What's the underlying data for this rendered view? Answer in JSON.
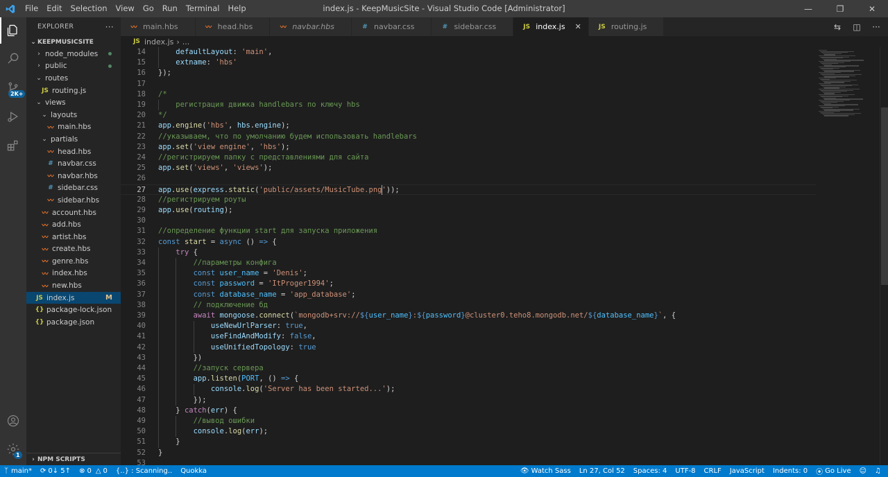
{
  "window": {
    "title": "index.js - KeepMusicSite - Visual Studio Code [Administrator]",
    "menu": [
      "File",
      "Edit",
      "Selection",
      "View",
      "Go",
      "Run",
      "Terminal",
      "Help"
    ]
  },
  "activity": {
    "scm_badge": "2K+",
    "settings_badge": "1"
  },
  "explorer": {
    "header": "EXPLORER",
    "more": "···",
    "folder": "KEEPMUSICSITE",
    "items": [
      {
        "label": "node_modules",
        "type": "folder",
        "open": false,
        "depth": 1,
        "status": "dot"
      },
      {
        "label": "public",
        "type": "folder",
        "open": false,
        "depth": 1,
        "status": "dot"
      },
      {
        "label": "routes",
        "type": "folder",
        "open": true,
        "depth": 1
      },
      {
        "label": "routing.js",
        "type": "js",
        "depth": 2
      },
      {
        "label": "views",
        "type": "folder",
        "open": true,
        "depth": 1
      },
      {
        "label": "layouts",
        "type": "folder",
        "open": true,
        "depth": 2
      },
      {
        "label": "main.hbs",
        "type": "hbs",
        "depth": 3
      },
      {
        "label": "partials",
        "type": "folder",
        "open": true,
        "depth": 2
      },
      {
        "label": "head.hbs",
        "type": "hbs",
        "depth": 3
      },
      {
        "label": "navbar.css",
        "type": "css",
        "depth": 3
      },
      {
        "label": "navbar.hbs",
        "type": "hbs",
        "depth": 3
      },
      {
        "label": "sidebar.css",
        "type": "css",
        "depth": 3
      },
      {
        "label": "sidebar.hbs",
        "type": "hbs",
        "depth": 3
      },
      {
        "label": "account.hbs",
        "type": "hbs",
        "depth": 2
      },
      {
        "label": "add.hbs",
        "type": "hbs",
        "depth": 2
      },
      {
        "label": "artist.hbs",
        "type": "hbs",
        "depth": 2
      },
      {
        "label": "create.hbs",
        "type": "hbs",
        "depth": 2
      },
      {
        "label": "genre.hbs",
        "type": "hbs",
        "depth": 2
      },
      {
        "label": "index.hbs",
        "type": "hbs",
        "depth": 2
      },
      {
        "label": "new.hbs",
        "type": "hbs",
        "depth": 2
      },
      {
        "label": "index.js",
        "type": "js",
        "depth": 1,
        "status": "M",
        "selected": true
      },
      {
        "label": "package-lock.json",
        "type": "json",
        "depth": 1
      },
      {
        "label": "package.json",
        "type": "json",
        "depth": 1
      }
    ],
    "npm_scripts": "NPM SCRIPTS"
  },
  "tabs": [
    {
      "label": "main.hbs",
      "type": "hbs"
    },
    {
      "label": "head.hbs",
      "type": "hbs"
    },
    {
      "label": "navbar.hbs",
      "type": "hbs",
      "italic": true
    },
    {
      "label": "navbar.css",
      "type": "css"
    },
    {
      "label": "sidebar.css",
      "type": "css"
    },
    {
      "label": "index.js",
      "type": "js",
      "active": true
    },
    {
      "label": "routing.js",
      "type": "js"
    }
  ],
  "breadcrumb": {
    "file": "index.js",
    "rest": "..."
  },
  "editor": {
    "current_line": 27,
    "lines": [
      {
        "n": 14,
        "t": [
          [
            "    ",
            "pl"
          ],
          [
            "defaultLayout",
            "var"
          ],
          [
            ": ",
            "pl"
          ],
          [
            "'main'",
            "str"
          ],
          [
            ",",
            "pl"
          ]
        ]
      },
      {
        "n": 15,
        "t": [
          [
            "    ",
            "pl"
          ],
          [
            "extname",
            "var"
          ],
          [
            ": ",
            "pl"
          ],
          [
            "'hbs'",
            "str"
          ]
        ]
      },
      {
        "n": 16,
        "t": [
          [
            "});",
            "pl"
          ]
        ]
      },
      {
        "n": 17,
        "t": []
      },
      {
        "n": 18,
        "t": [
          [
            "/*",
            "com"
          ]
        ]
      },
      {
        "n": 19,
        "t": [
          [
            "    регистрация движка handlebars по ключу hbs",
            "com"
          ]
        ]
      },
      {
        "n": 20,
        "t": [
          [
            "*/",
            "com"
          ]
        ]
      },
      {
        "n": 21,
        "t": [
          [
            "app",
            "var"
          ],
          [
            ".",
            "pl"
          ],
          [
            "engine",
            "fn"
          ],
          [
            "(",
            "pl"
          ],
          [
            "'hbs'",
            "str"
          ],
          [
            ", ",
            "pl"
          ],
          [
            "hbs",
            "var"
          ],
          [
            ".",
            "pl"
          ],
          [
            "engine",
            "var"
          ],
          [
            ");",
            "pl"
          ]
        ]
      },
      {
        "n": 22,
        "t": [
          [
            "//указываем, что по умолчанию будем использовать handlebars",
            "com"
          ]
        ]
      },
      {
        "n": 23,
        "t": [
          [
            "app",
            "var"
          ],
          [
            ".",
            "pl"
          ],
          [
            "set",
            "fn"
          ],
          [
            "(",
            "pl"
          ],
          [
            "'view engine'",
            "str"
          ],
          [
            ", ",
            "pl"
          ],
          [
            "'hbs'",
            "str"
          ],
          [
            ");",
            "pl"
          ]
        ]
      },
      {
        "n": 24,
        "t": [
          [
            "//регистрируем папку с представлениями для сайта",
            "com"
          ]
        ]
      },
      {
        "n": 25,
        "t": [
          [
            "app",
            "var"
          ],
          [
            ".",
            "pl"
          ],
          [
            "set",
            "fn"
          ],
          [
            "(",
            "pl"
          ],
          [
            "'views'",
            "str"
          ],
          [
            ", ",
            "pl"
          ],
          [
            "'views'",
            "str"
          ],
          [
            ");",
            "pl"
          ]
        ]
      },
      {
        "n": 26,
        "t": []
      },
      {
        "n": 27,
        "t": [
          [
            "app",
            "var"
          ],
          [
            ".",
            "pl"
          ],
          [
            "use",
            "fn"
          ],
          [
            "(",
            "pl"
          ],
          [
            "express",
            "var"
          ],
          [
            ".",
            "pl"
          ],
          [
            "static",
            "fn"
          ],
          [
            "(",
            "pl"
          ],
          [
            "'public/assets/MusicTube.png'",
            "str"
          ],
          [
            "));",
            "pl"
          ]
        ]
      },
      {
        "n": 28,
        "t": [
          [
            "//регистрируем роуты",
            "com"
          ]
        ]
      },
      {
        "n": 29,
        "t": [
          [
            "app",
            "var"
          ],
          [
            ".",
            "pl"
          ],
          [
            "use",
            "fn"
          ],
          [
            "(",
            "pl"
          ],
          [
            "routing",
            "var"
          ],
          [
            ");",
            "pl"
          ]
        ]
      },
      {
        "n": 30,
        "t": []
      },
      {
        "n": 31,
        "t": [
          [
            "//определение функции start для запуска приложения",
            "com"
          ]
        ]
      },
      {
        "n": 32,
        "t": [
          [
            "const ",
            "kw"
          ],
          [
            "start",
            "fn"
          ],
          [
            " = ",
            "pl"
          ],
          [
            "async",
            "kw"
          ],
          [
            " () ",
            "pl"
          ],
          [
            "=>",
            "kw"
          ],
          [
            " {",
            "pl"
          ]
        ]
      },
      {
        "n": 33,
        "t": [
          [
            "    ",
            "pl"
          ],
          [
            "try",
            "ctl"
          ],
          [
            " {",
            "pl"
          ]
        ]
      },
      {
        "n": 34,
        "t": [
          [
            "        ",
            "pl"
          ],
          [
            "//параметры конфига",
            "com"
          ]
        ]
      },
      {
        "n": 35,
        "t": [
          [
            "        ",
            "pl"
          ],
          [
            "const ",
            "kw"
          ],
          [
            "user_name",
            "cst"
          ],
          [
            " = ",
            "pl"
          ],
          [
            "'Denis'",
            "str"
          ],
          [
            ";",
            "pl"
          ]
        ]
      },
      {
        "n": 36,
        "t": [
          [
            "        ",
            "pl"
          ],
          [
            "const ",
            "kw"
          ],
          [
            "password",
            "cst"
          ],
          [
            " = ",
            "pl"
          ],
          [
            "'ItProger1994'",
            "str"
          ],
          [
            ";",
            "pl"
          ]
        ]
      },
      {
        "n": 37,
        "t": [
          [
            "        ",
            "pl"
          ],
          [
            "const ",
            "kw"
          ],
          [
            "database_name",
            "cst"
          ],
          [
            " = ",
            "pl"
          ],
          [
            "'app_database'",
            "str"
          ],
          [
            ";",
            "pl"
          ]
        ]
      },
      {
        "n": 38,
        "t": [
          [
            "        ",
            "pl"
          ],
          [
            "// подключение бд",
            "com"
          ]
        ]
      },
      {
        "n": 39,
        "t": [
          [
            "        ",
            "pl"
          ],
          [
            "await ",
            "ctl"
          ],
          [
            "mongoose",
            "var"
          ],
          [
            ".",
            "pl"
          ],
          [
            "connect",
            "fn"
          ],
          [
            "(",
            "pl"
          ],
          [
            "`mongodb+srv://",
            "str"
          ],
          [
            "${",
            "kw"
          ],
          [
            "user_name",
            "cst"
          ],
          [
            "}",
            "kw"
          ],
          [
            ":",
            "str"
          ],
          [
            "${",
            "kw"
          ],
          [
            "password",
            "cst"
          ],
          [
            "}",
            "kw"
          ],
          [
            "@cluster0.teho8.mongodb.net/",
            "str"
          ],
          [
            "${",
            "kw"
          ],
          [
            "database_name",
            "cst"
          ],
          [
            "}",
            "kw"
          ],
          [
            "`",
            "str"
          ],
          [
            ", {",
            "pl"
          ]
        ]
      },
      {
        "n": 40,
        "t": [
          [
            "            ",
            "pl"
          ],
          [
            "useNewUrlParser",
            "var"
          ],
          [
            ": ",
            "pl"
          ],
          [
            "true",
            "kw"
          ],
          [
            ",",
            "pl"
          ]
        ]
      },
      {
        "n": 41,
        "t": [
          [
            "            ",
            "pl"
          ],
          [
            "useFindAndModify",
            "var"
          ],
          [
            ": ",
            "pl"
          ],
          [
            "false",
            "kw"
          ],
          [
            ",",
            "pl"
          ]
        ]
      },
      {
        "n": 42,
        "t": [
          [
            "            ",
            "pl"
          ],
          [
            "useUnifiedTopology",
            "var"
          ],
          [
            ": ",
            "pl"
          ],
          [
            "true",
            "kw"
          ]
        ]
      },
      {
        "n": 43,
        "t": [
          [
            "        })",
            "pl"
          ]
        ]
      },
      {
        "n": 44,
        "t": [
          [
            "        ",
            "pl"
          ],
          [
            "//запуск сервера",
            "com"
          ]
        ]
      },
      {
        "n": 45,
        "t": [
          [
            "        ",
            "pl"
          ],
          [
            "app",
            "var"
          ],
          [
            ".",
            "pl"
          ],
          [
            "listen",
            "fn"
          ],
          [
            "(",
            "pl"
          ],
          [
            "PORT",
            "cst"
          ],
          [
            ", () ",
            "pl"
          ],
          [
            "=>",
            "kw"
          ],
          [
            " {",
            "pl"
          ]
        ]
      },
      {
        "n": 46,
        "t": [
          [
            "            ",
            "pl"
          ],
          [
            "console",
            "var"
          ],
          [
            ".",
            "pl"
          ],
          [
            "log",
            "fn"
          ],
          [
            "(",
            "pl"
          ],
          [
            "'Server has been started...'",
            "str"
          ],
          [
            ");",
            "pl"
          ]
        ]
      },
      {
        "n": 47,
        "t": [
          [
            "        });",
            "pl"
          ]
        ]
      },
      {
        "n": 48,
        "t": [
          [
            "    } ",
            "pl"
          ],
          [
            "catch",
            "ctl"
          ],
          [
            "(",
            "pl"
          ],
          [
            "err",
            "var"
          ],
          [
            ") {",
            "pl"
          ]
        ]
      },
      {
        "n": 49,
        "t": [
          [
            "        ",
            "pl"
          ],
          [
            "//вывод ошибки",
            "com"
          ]
        ]
      },
      {
        "n": 50,
        "t": [
          [
            "        ",
            "pl"
          ],
          [
            "console",
            "var"
          ],
          [
            ".",
            "pl"
          ],
          [
            "log",
            "fn"
          ],
          [
            "(",
            "pl"
          ],
          [
            "err",
            "var"
          ],
          [
            ");",
            "pl"
          ]
        ]
      },
      {
        "n": 51,
        "t": [
          [
            "    }",
            "pl"
          ]
        ]
      },
      {
        "n": 52,
        "t": [
          [
            "}",
            "pl"
          ]
        ]
      },
      {
        "n": 53,
        "t": []
      }
    ]
  },
  "statusbar": {
    "branch": "main*",
    "sync": "0↓ 5↑",
    "problems_errors": "0",
    "problems_warnings": "0",
    "scanning": "{..} : Scanning..",
    "quokka": "Quokka",
    "watch_sass": "Watch Sass",
    "position": "Ln 27, Col 52",
    "spaces": "Spaces: 4",
    "encoding": "UTF-8",
    "eol": "CRLF",
    "language": "JavaScript",
    "indents": "Indents: 0",
    "golive": "Go Live"
  }
}
